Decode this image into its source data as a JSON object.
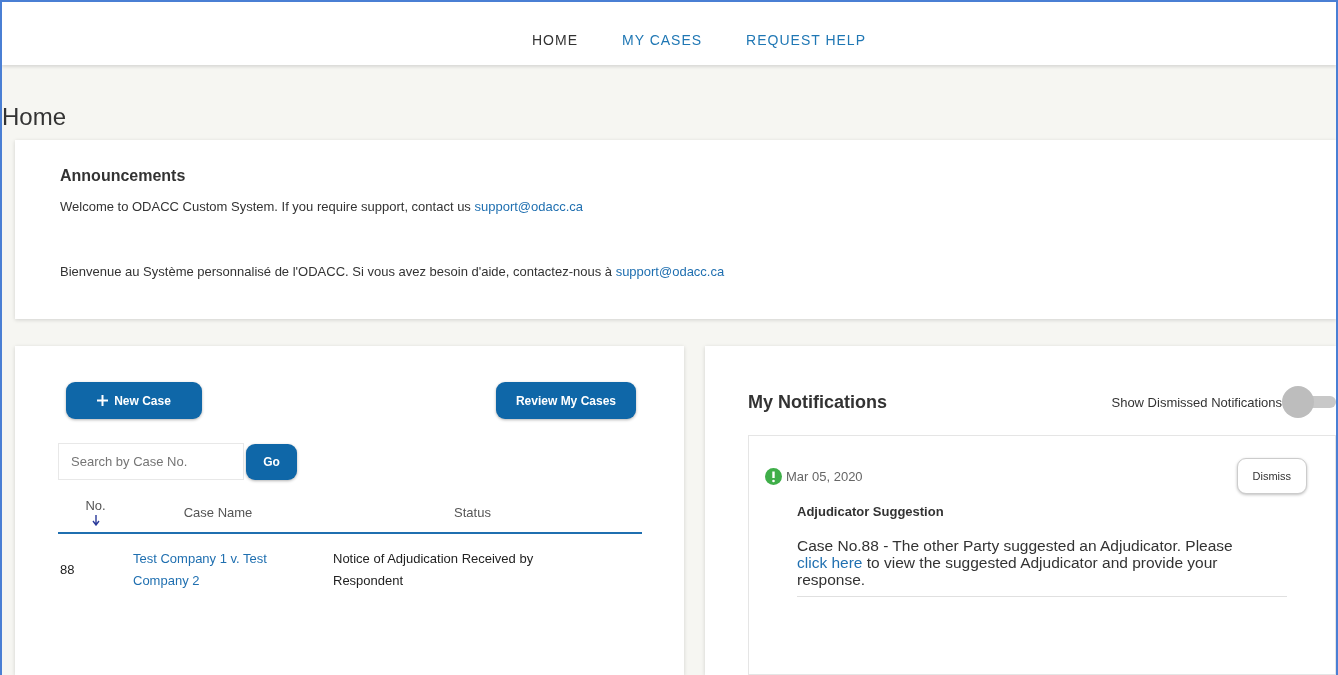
{
  "nav": [
    {
      "label": "HOME",
      "selected": true
    },
    {
      "label": "MY CASES",
      "selected": false
    },
    {
      "label": "REQUEST HELP",
      "selected": false
    }
  ],
  "page_title": "Home",
  "announcements": {
    "title": "Announcements",
    "paragraphs": [
      {
        "text": "Welcome to ODACC Custom System. If you require support, contact us ",
        "link": "support@odacc.ca"
      },
      {
        "text": "Bienvenue au Système personnalisé de l'ODACC. Si vous avez besoin d'aide, contactez-nous à ",
        "link": "support@odacc.ca"
      }
    ]
  },
  "cases": {
    "new_case_button": "New Case",
    "review_button": "Review My Cases",
    "search": {
      "placeholder": "Search by Case No."
    },
    "go_button": "Go",
    "columns": [
      {
        "label": "No.",
        "sorted": true
      },
      {
        "label": "Case Name",
        "sorted": false
      },
      {
        "label": "Status",
        "sorted": false
      }
    ],
    "rows": [
      {
        "no": "88",
        "case_name": "Test Company 1 v. Test Company 2",
        "status": "Notice of Adjudication Received by Respondent"
      }
    ]
  },
  "notifications": {
    "title": "My Notifications",
    "show_dismissed": {
      "label": "Show Dismissed Notifications",
      "on": false
    },
    "items": [
      {
        "date": "Mar 05, 2020",
        "dismiss_button": "Dismiss",
        "title": "Adjudicator Suggestion",
        "before": "Case No.88 - The other Party suggested an Adjudicator. Please ",
        "link": "click here",
        "after": " to view the suggested Adjudicator and provide your response."
      }
    ]
  }
}
